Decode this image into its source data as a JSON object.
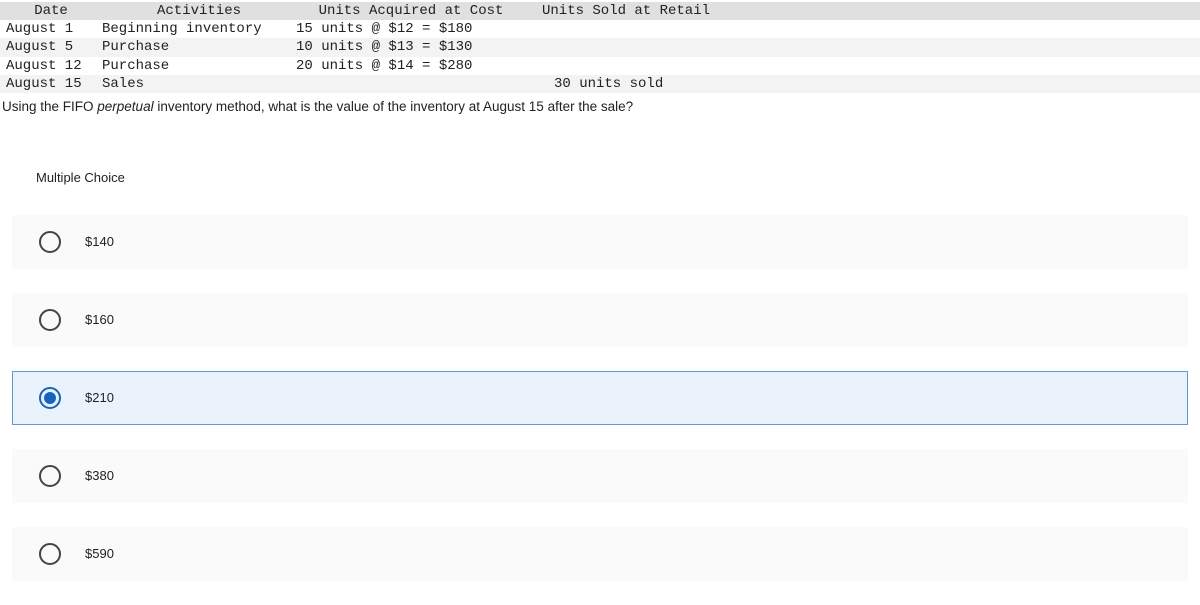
{
  "table": {
    "headers": {
      "date": "Date",
      "activities": "Activities",
      "cost": "Units Acquired at Cost",
      "sold": "Units Sold at Retail"
    },
    "rows": [
      {
        "date": "August 1",
        "activities": "Beginning inventory",
        "cost": "15 units @ $12 = $180",
        "sold": ""
      },
      {
        "date": "August 5",
        "activities": "Purchase",
        "cost": "10 units @ $13 = $130",
        "sold": ""
      },
      {
        "date": "August 12",
        "activities": "Purchase",
        "cost": "20 units @ $14 = $280",
        "sold": ""
      },
      {
        "date": "August 15",
        "activities": "Sales",
        "cost": "",
        "sold": "30 units sold"
      }
    ]
  },
  "question_pre": "Using the FIFO ",
  "question_ital": "perpetual",
  "question_post": " inventory method, what is the value of the inventory at August 15 after the sale?",
  "mc_label": "Multiple Choice",
  "choices": [
    {
      "label": "$140",
      "selected": false
    },
    {
      "label": "$160",
      "selected": false
    },
    {
      "label": "$210",
      "selected": true
    },
    {
      "label": "$380",
      "selected": false
    },
    {
      "label": "$590",
      "selected": false
    }
  ]
}
